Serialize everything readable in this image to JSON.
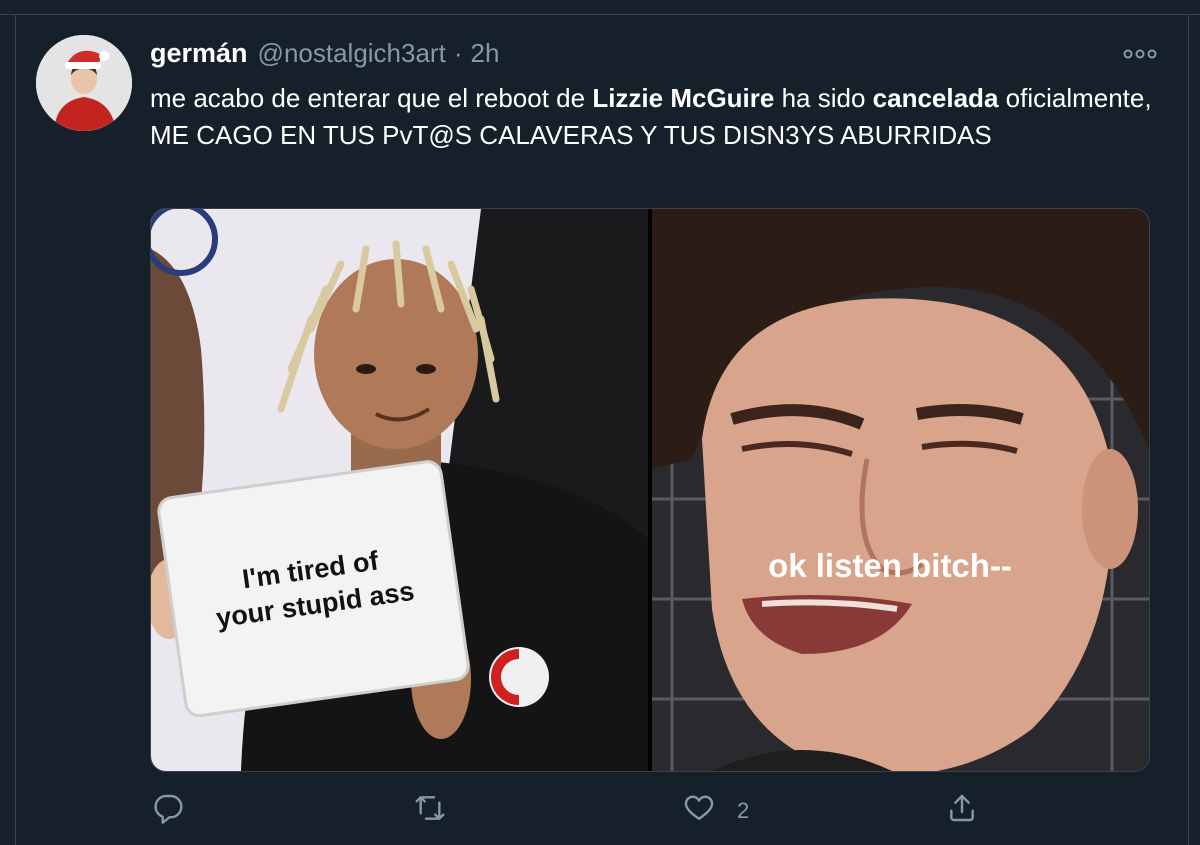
{
  "tweet": {
    "display_name": "germán",
    "handle": "@nostalgich3art",
    "separator": "·",
    "time": "2h",
    "text_parts": {
      "p1": "me acabo de enterar que el reboot de ",
      "b1": "Lizzie McGuire",
      "p2": " ha sido ",
      "b2": "cancelada",
      "p3": " oficialmente, ME CAGO EN TUS PvT@S CALAVERAS Y TUS DISN3YS ABURRIDAS"
    }
  },
  "media": {
    "left_caption_line1": "I'm tired of",
    "left_caption_line2": "your stupid ass",
    "right_caption": "ok listen bitch--"
  },
  "actions": {
    "reply_count": "",
    "retweet_count": "",
    "like_count": "2",
    "share_count": ""
  },
  "colors": {
    "background": "#15202b",
    "secondary_text": "#8899a6",
    "border": "#38444d"
  },
  "icons": [
    "more-icon",
    "reply-icon",
    "retweet-icon",
    "like-icon",
    "share-icon"
  ]
}
